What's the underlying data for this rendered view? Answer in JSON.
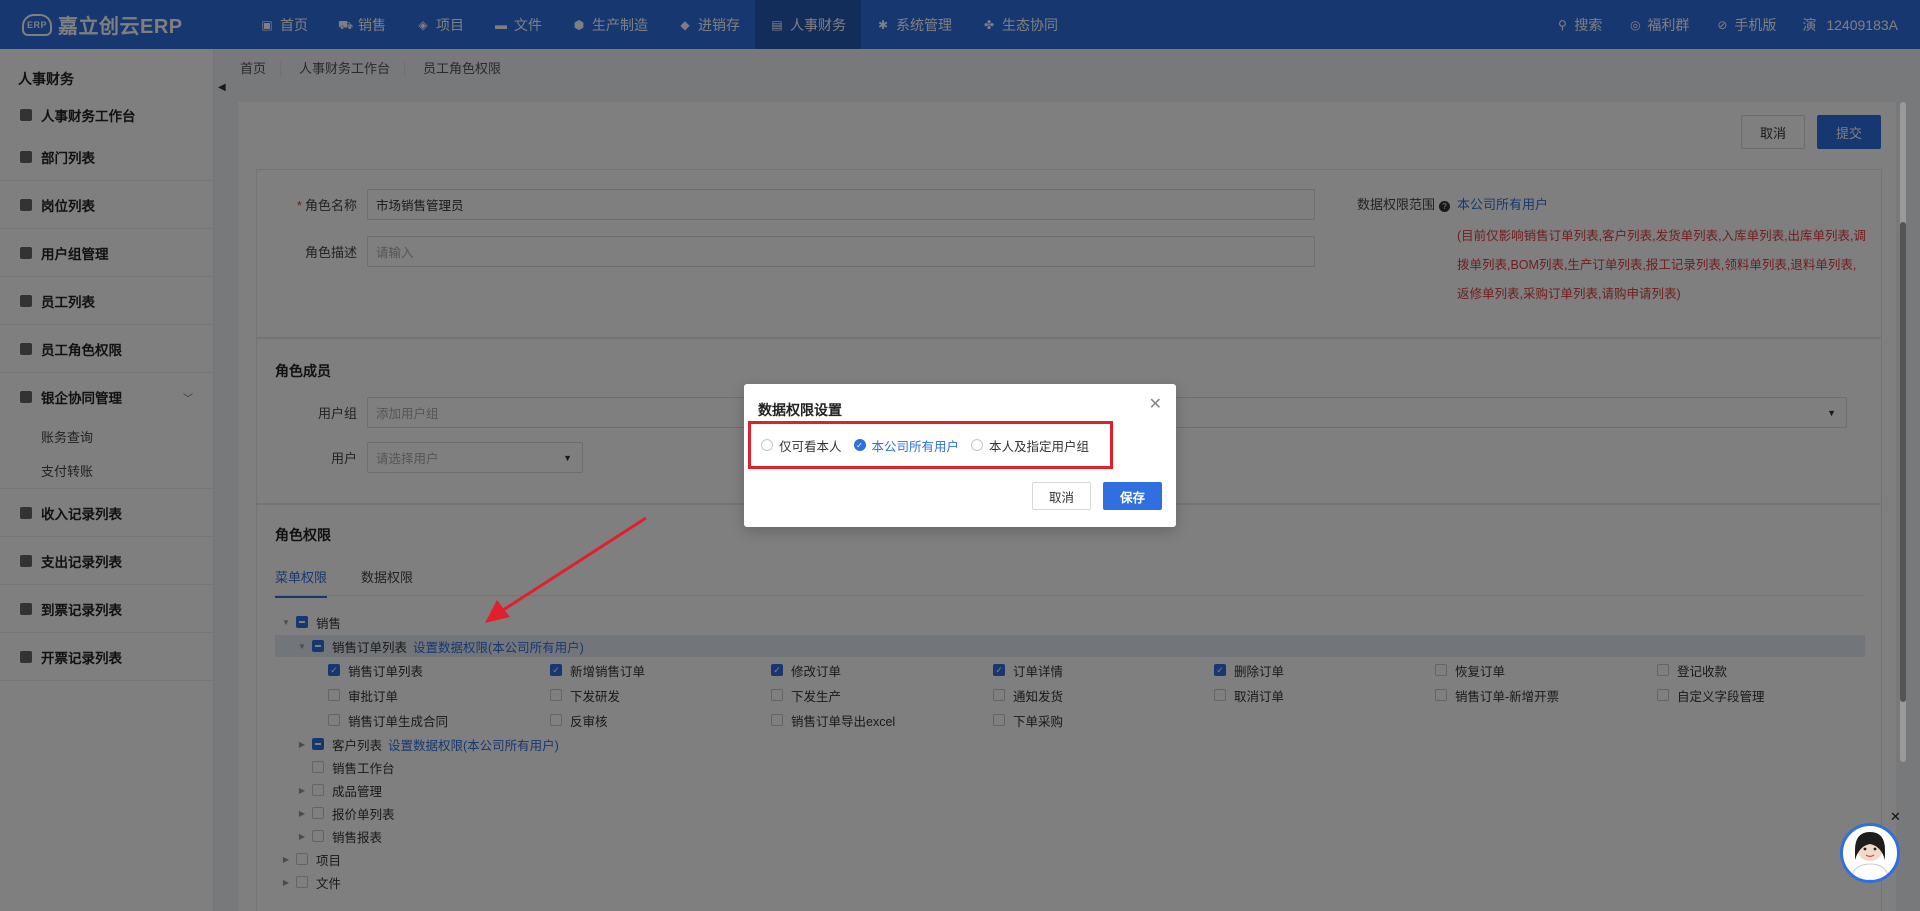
{
  "app": {
    "logo_mark": "ERP",
    "logo": "嘉立创云ERP"
  },
  "nav": [
    {
      "label": "首页",
      "icon": "monitor-icon"
    },
    {
      "label": "销售",
      "icon": "cart-icon"
    },
    {
      "label": "项目",
      "icon": "layers-icon"
    },
    {
      "label": "文件",
      "icon": "folder-icon"
    },
    {
      "label": "生产制造",
      "icon": "factory-icon"
    },
    {
      "label": "进销存",
      "icon": "box-icon"
    },
    {
      "label": "人事财务",
      "icon": "id-card-icon"
    },
    {
      "label": "系统管理",
      "icon": "gear-icon"
    },
    {
      "label": "生态协同",
      "icon": "cluster-icon"
    }
  ],
  "tools": {
    "search": "搜索",
    "welfare": "福利群",
    "mobile": "手机版",
    "user_badge": "演",
    "user": "12409183A"
  },
  "sidebar": {
    "title": "人事财务",
    "items": [
      {
        "label": "人事财务工作台"
      },
      {
        "label": "部门列表"
      },
      {
        "label": "岗位列表"
      },
      {
        "label": "用户组管理"
      },
      {
        "label": "员工列表"
      },
      {
        "label": "员工角色权限"
      },
      {
        "label": "银企协同管理"
      },
      {
        "label": "收入记录列表"
      },
      {
        "label": "支出记录列表"
      },
      {
        "label": "到票记录列表"
      },
      {
        "label": "开票记录列表"
      }
    ],
    "sub": [
      "账务查询",
      "支付转账"
    ]
  },
  "breadcrumb": [
    "首页",
    "人事财务工作台",
    "员工角色权限"
  ],
  "actions": {
    "cancel": "取消",
    "submit": "提交"
  },
  "form": {
    "role_name_label": "角色名称",
    "role_name": "市场销售管理员",
    "role_desc_label": "角色描述",
    "role_desc_placeholder": "请输入",
    "scope_label": "数据权限范围",
    "scope_value": "本公司所有用户",
    "scope_desc": "(目前仅影响销售订单列表,客户列表,发货单列表,入库单列表,出库单列表,调拨单列表,BOM列表,生产订单列表,报工记录列表,领料单列表,退料单列表,返修单列表,采购订单列表,请购申请列表)"
  },
  "members": {
    "title": "角色成员",
    "group_label": "用户组",
    "group_placeholder": "添加用户组",
    "user_label": "用户",
    "user_placeholder": "请选择用户"
  },
  "perm": {
    "title": "角色权限",
    "tabs": [
      "菜单权限",
      "数据权限"
    ],
    "sales": "销售",
    "order_list": "销售订单列表",
    "set_link": "设置数据权限(本公司所有用户)",
    "leaves": [
      [
        "销售订单列表",
        "新增销售订单",
        "修改订单",
        "订单详情",
        "删除订单",
        "恢复订单",
        "登记收款"
      ],
      [
        "审批订单",
        "下发研发",
        "下发生产",
        "通知发货",
        "取消订单",
        "销售订单-新增开票",
        "自定义字段管理"
      ],
      [
        "销售订单生成合同",
        "反审核",
        "销售订单导出excel",
        "下单采购"
      ]
    ],
    "customer_list": "客户列表",
    "customer_link": "设置数据权限(本公司所有用户)",
    "others": [
      "销售工作台",
      "成品管理",
      "报价单列表",
      "销售报表"
    ],
    "project": "项目",
    "file": "文件"
  },
  "modal": {
    "title": "数据权限设置",
    "options": [
      "仅可看本人",
      "本公司所有用户",
      "本人及指定用户组"
    ],
    "selected": "本公司所有用户",
    "cancel": "取消",
    "save": "保存"
  }
}
